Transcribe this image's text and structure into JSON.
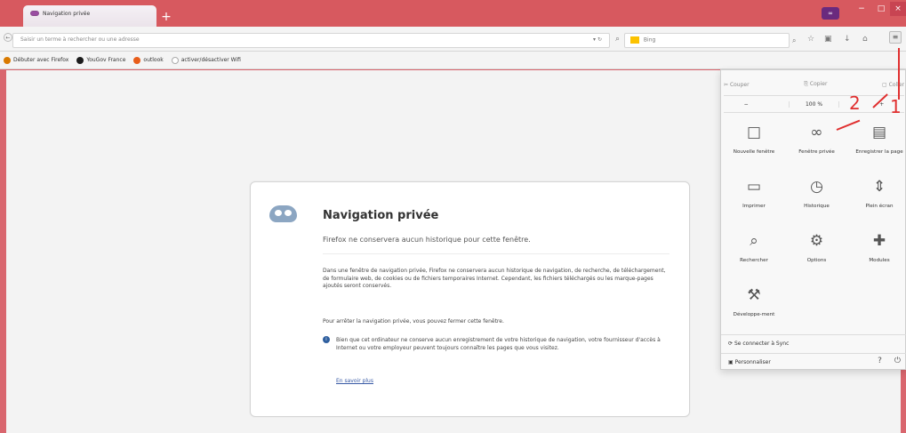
{
  "browser": {
    "tab_title": "Navigation privée",
    "url_placeholder": "Saisir un terme à rechercher ou une adresse",
    "search_engine": "Bing",
    "window_indicator": "∞"
  },
  "bookmarks": [
    {
      "label": "Débuter avec Firefox",
      "color": "#d97a00"
    },
    {
      "label": "YouGov France",
      "color": "#1c1c1c"
    },
    {
      "label": "outlook",
      "color": "#e85d1a"
    },
    {
      "label": "activer/désactiver Wifi",
      "color": "#ffffff"
    }
  ],
  "page": {
    "title": "Navigation privée",
    "subtitle": "Firefox ne conservera aucun historique pour cette fenêtre.",
    "paragraph_1": "Dans une fenêtre de navigation privée, Firefox ne conservera aucun historique de navigation, de recherche, de téléchargement, de formulaire web, de cookies ou de fichiers temporaires Internet. Cependant, les fichiers téléchargés ou les marque-pages ajoutés seront conservés.",
    "paragraph_2": "Pour arrêter la navigation privée, vous pouvez fermer cette fenêtre.",
    "paragraph_3": "Bien que cet ordinateur ne conserve aucun enregistrement de votre historique de navigation, votre fournisseur d'accès à Internet ou votre employeur peuvent toujours connaître les pages que vous visitez.",
    "learn_more": "En savoir plus"
  },
  "menu": {
    "cut": "Couper",
    "copy": "Copier",
    "paste": "Coller",
    "zoom_minus": "−",
    "zoom": "100 %",
    "zoom_plus": "+",
    "items": [
      {
        "label": "Nouvelle fenêtre",
        "icon": "window-icon"
      },
      {
        "label": "Fenêtre privée",
        "icon": "private-mask-icon"
      },
      {
        "label": "Enregistrer la page",
        "icon": "page-icon"
      },
      {
        "label": "Imprimer",
        "icon": "printer-icon"
      },
      {
        "label": "Historique",
        "icon": "clock-icon"
      },
      {
        "label": "Plein écran",
        "icon": "fullscreen-icon"
      },
      {
        "label": "Rechercher",
        "icon": "search-icon"
      },
      {
        "label": "Options",
        "icon": "gear-icon"
      },
      {
        "label": "Modules",
        "icon": "puzzle-icon"
      },
      {
        "label": "Développe-ment",
        "icon": "wrench-icon"
      }
    ],
    "sync": "Se connecter à Sync",
    "customize": "Personnaliser"
  },
  "annotations": {
    "first": "1",
    "second": "2"
  },
  "colors": {
    "annotation_red": "#e02f2f",
    "frame": "#d9666e"
  }
}
